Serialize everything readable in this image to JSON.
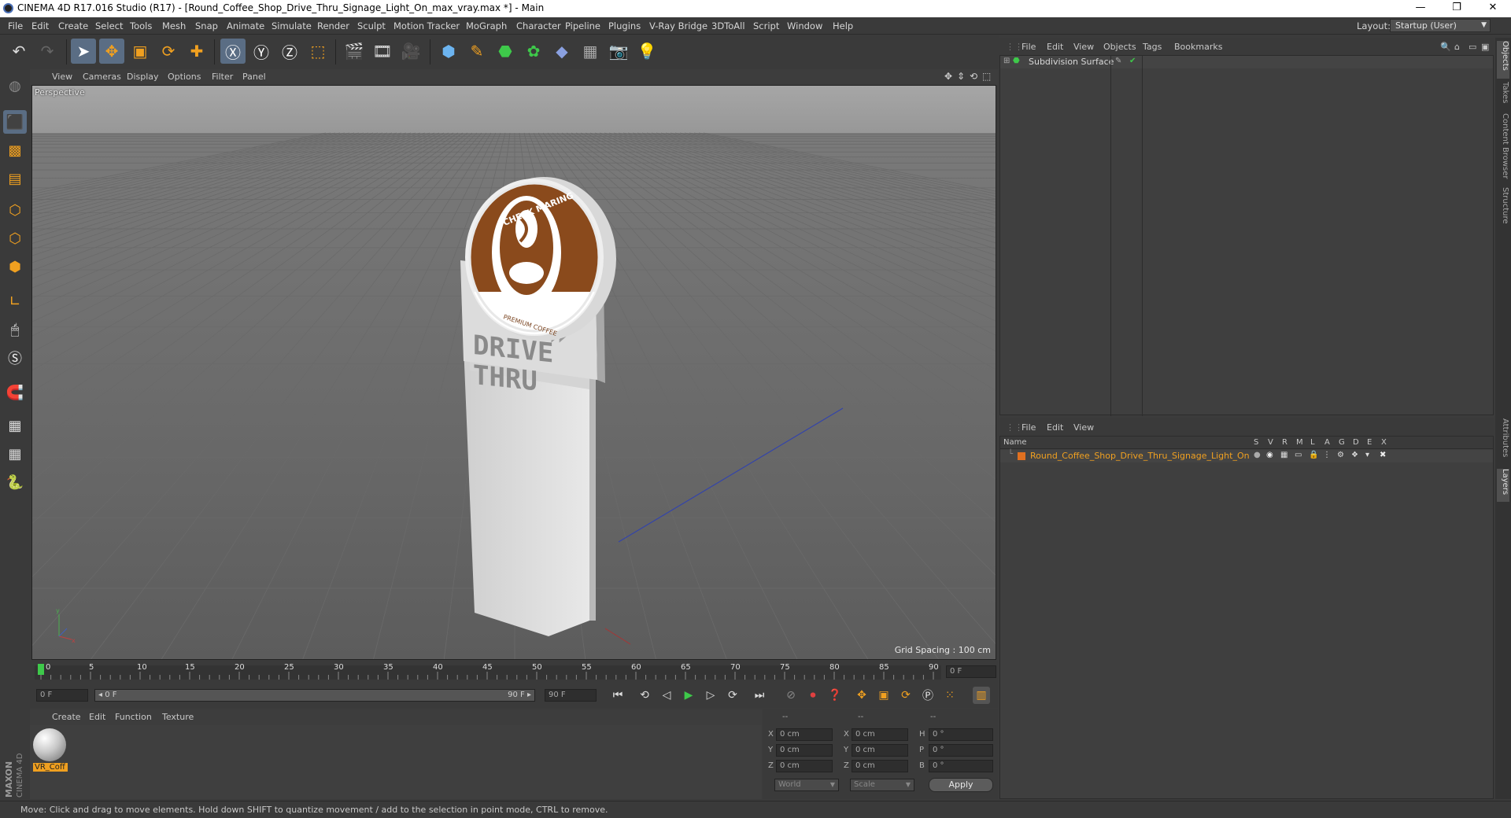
{
  "window": {
    "title": "CINEMA 4D R17.016 Studio (R17) - [Round_Coffee_Shop_Drive_Thru_Signage_Light_On_max_vray.max *] - Main",
    "minimize": "—",
    "restore": "❐",
    "close": "✕"
  },
  "menu": [
    "File",
    "Edit",
    "Create",
    "Select",
    "Tools",
    "Mesh",
    "Snap",
    "Animate",
    "Simulate",
    "Render",
    "Sculpt",
    "Motion Tracker",
    "MoGraph",
    "Character",
    "Pipeline",
    "Plugins",
    "V-Ray Bridge",
    "3DToAll",
    "Script",
    "Window",
    "Help"
  ],
  "layout": {
    "label": "Layout:",
    "value": "Startup (User)"
  },
  "viewport": {
    "menu": [
      "View",
      "Cameras",
      "Display",
      "Options",
      "Filter",
      "Panel"
    ],
    "label": "Perspective",
    "grid_spacing": "Grid Spacing : 100 cm",
    "sign": {
      "logo_top": "CHECK MARING",
      "logo_bottom": "PREMIUM COFFEE",
      "panel_line1": "DRIVE",
      "panel_line2": "THRU"
    }
  },
  "timeline": {
    "ticks": [
      "0",
      "5",
      "10",
      "15",
      "20",
      "25",
      "30",
      "35",
      "40",
      "45",
      "50",
      "55",
      "60",
      "65",
      "70",
      "75",
      "80",
      "85",
      "90"
    ],
    "current_frame": "0 F",
    "start": "0 F",
    "range_start": "◂ 0 F",
    "range_end": "90 F ▸",
    "end": "90 F"
  },
  "material": {
    "menu": [
      "Create",
      "Edit",
      "Function",
      "Texture"
    ],
    "swatch_label": "VR_Coff"
  },
  "coords": {
    "headers": [
      "--",
      "--",
      "--"
    ],
    "rows": [
      {
        "a": "X",
        "av": "0 cm",
        "b": "X",
        "bv": "0 cm",
        "c": "H",
        "cv": "0 °"
      },
      {
        "a": "Y",
        "av": "0 cm",
        "b": "Y",
        "bv": "0 cm",
        "c": "P",
        "cv": "0 °"
      },
      {
        "a": "Z",
        "av": "0 cm",
        "b": "Z",
        "bv": "0 cm",
        "c": "B",
        "cv": "0 °"
      }
    ],
    "world": "World",
    "scale": "Scale",
    "apply": "Apply"
  },
  "objects": {
    "menu": [
      "File",
      "Edit",
      "View",
      "Objects",
      "Tags",
      "Bookmarks"
    ],
    "item": "Subdivision Surface"
  },
  "layers": {
    "menu": [
      "File",
      "Edit",
      "View"
    ],
    "name_col": "Name",
    "cols": [
      "S",
      "V",
      "R",
      "M",
      "L",
      "A",
      "G",
      "D",
      "E",
      "X"
    ],
    "item": "Round_Coffee_Shop_Drive_Thru_Signage_Light_On"
  },
  "right_tabs": [
    "Objects",
    "Takes",
    "Content Browser",
    "Structure",
    "Attributes",
    "Layers"
  ],
  "status": "Move: Click and drag to move elements. Hold down SHIFT to quantize movement / add to the selection in point mode, CTRL to remove.",
  "brand": {
    "line1": "MAXON",
    "line2": "CINEMA 4D"
  },
  "colors": {
    "accent": "#5a6d84",
    "orange": "#f0a020",
    "green": "#3ec94a"
  }
}
